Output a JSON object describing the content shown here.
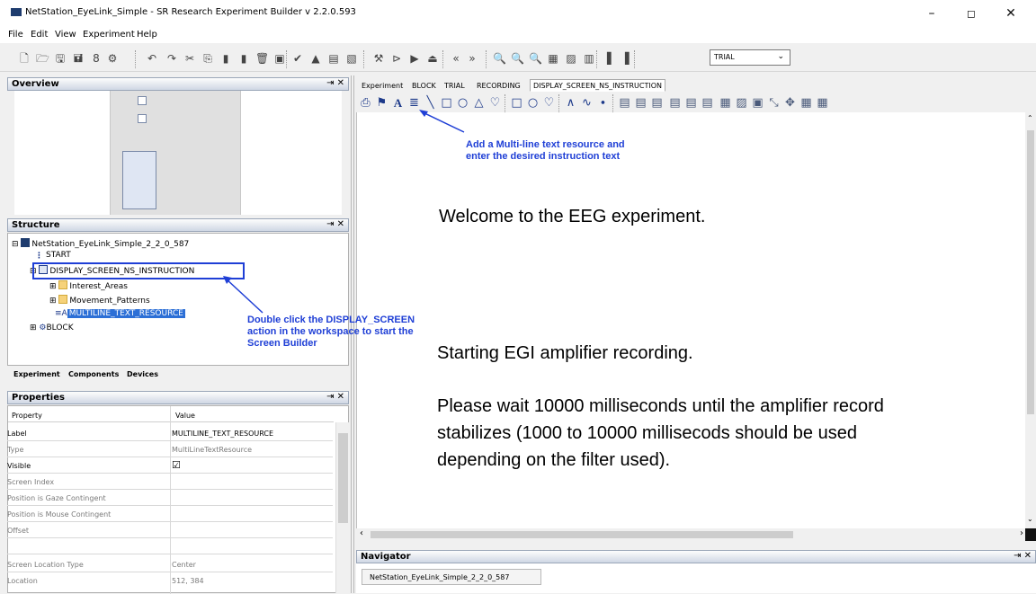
{
  "window": {
    "title": "NetStation_EyeLink_Simple - SR Research Experiment Builder v 2.2.0.593",
    "minimize": "–",
    "restore": "◻",
    "close": "✕"
  },
  "menu": [
    "File",
    "Edit",
    "View",
    "Experiment",
    "Help"
  ],
  "toolbar": {
    "icons": [
      "new-icon",
      "open-icon",
      "save-icon",
      "save-as-icon",
      "build-icon",
      "package-icon",
      "undo-icon",
      "redo-icon",
      "cut-icon",
      "copy-icon",
      "paste-icon",
      "paste2-icon",
      "delete-icon",
      "find-icon",
      "check-icon",
      "build-project-icon",
      "test-run-icon",
      "deploy-icon",
      "tools-icon",
      "play-icon",
      "run-icon",
      "flow-icon",
      "back-icon",
      "forward-icon",
      "zoom-icon",
      "zoom-in-icon",
      "zoom-out-icon",
      "grid-icon",
      "chart-icon",
      "table-icon",
      "align-icon",
      "layout-icon"
    ],
    "trial_select": "TRIAL",
    "back_glyph": "«",
    "forward_glyph": "»"
  },
  "overview": {
    "title": "Overview",
    "pin": "⇥ ✕"
  },
  "structure": {
    "title": "Structure",
    "pin": "⇥ ✕",
    "root": "NetStation_EyeLink_Simple_2_2_0_587",
    "start": "START",
    "display_screen": "DISPLAY_SCREEN_NS_INSTRUCTION",
    "interest_areas": "Interest_Areas",
    "movement_patterns": "Movement_Patterns",
    "multiline": "MULTILINE_TEXT_RESOURCE",
    "block": "BLOCK",
    "tabs": [
      "Experiment",
      "Components",
      "Devices"
    ]
  },
  "properties": {
    "title": "Properties",
    "pin": "⇥ ✕",
    "col_property": "Property",
    "col_value": "Value",
    "rows": [
      {
        "property": "Label",
        "value": "MULTILINE_TEXT_RESOURCE"
      },
      {
        "property": "Type",
        "value": "MultiLineTextResource"
      },
      {
        "property": "Visible",
        "value": "☑"
      },
      {
        "property": "Screen Index",
        "value": ""
      },
      {
        "property": "Position is Gaze Contingent",
        "value": ""
      },
      {
        "property": "Position is Mouse Contingent",
        "value": ""
      },
      {
        "property": "Offset",
        "value": ""
      },
      {
        "property": "",
        "value": ""
      },
      {
        "property": "Screen Location Type",
        "value": "Center"
      },
      {
        "property": "Location",
        "value": "512, 384"
      }
    ]
  },
  "editor": {
    "tabs": [
      "Experiment",
      "BLOCK",
      "TRIAL",
      "RECORDING",
      "DISPLAY_SCREEN_NS_INSTRUCTION"
    ],
    "active_tab": "DISPLAY_SCREEN_NS_INSTRUCTION",
    "canvas_text": {
      "welcome": "Welcome to the EEG experiment.",
      "starting": "Starting EGI amplifier recording.",
      "wait1": "Please wait 10000 milliseconds until the amplifier record",
      "wait2": "stabilizes (1000 to 10000 millisecods should be used",
      "wait3": "depending on the filter used)."
    }
  },
  "annotations": {
    "multiline_1": "Add a Multi-line text resource and",
    "multiline_2": "enter the desired instruction text",
    "dblclick_1": "Double click the DISPLAY_SCREEN",
    "dblclick_2": "action in the workspace to start the",
    "dblclick_3": "Screen Builder",
    "color": "#1f3fd6"
  },
  "navigator": {
    "title": "Navigator",
    "pin": "⇥ ✕",
    "item": "NetStation_EyeLink_Simple_2_2_0_587"
  }
}
